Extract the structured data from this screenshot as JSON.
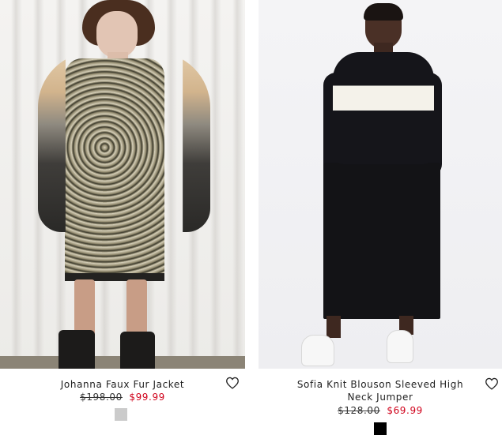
{
  "products": [
    {
      "name": "Johanna Faux Fur Jacket",
      "original_price": "$198.00",
      "sale_price": "$99.99",
      "swatch_color": "#cbcbcb",
      "wishlist_icon": "heart-outline-icon"
    },
    {
      "name": "Sofia Knit Blouson Sleeved High Neck Jumper",
      "original_price": "$128.00",
      "sale_price": "$69.99",
      "swatch_color": "#000000",
      "wishlist_icon": "heart-outline-icon"
    }
  ],
  "colors": {
    "sale": "#d0021b",
    "text": "#1f1f1f"
  }
}
